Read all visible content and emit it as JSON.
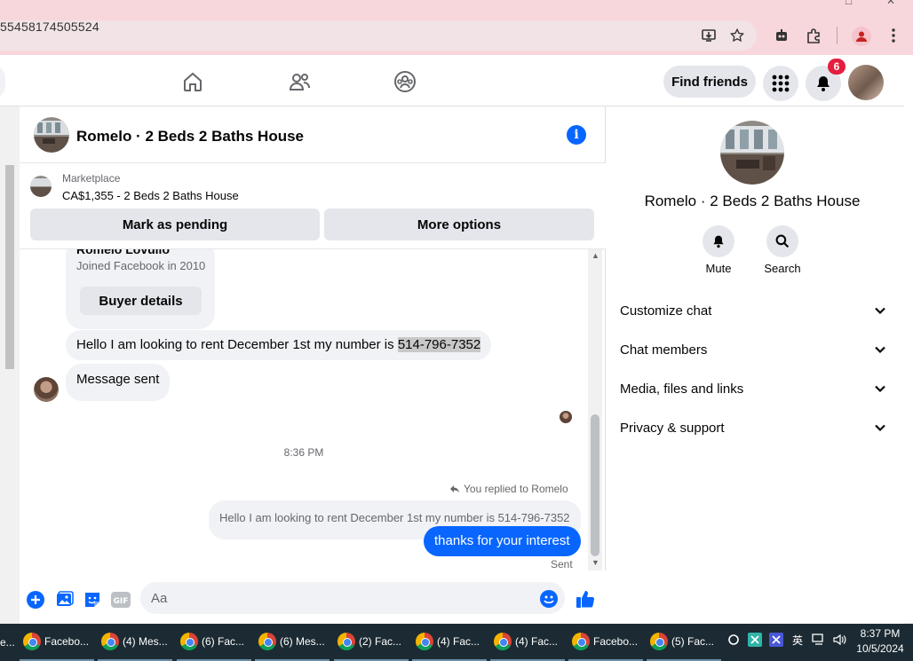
{
  "browser": {
    "url_fragment": "55458174505524",
    "window_controls": [
      "□",
      "✕"
    ]
  },
  "topnav": {
    "find_friends_label": "Find friends",
    "notifications_count": "6"
  },
  "chat": {
    "title": "Romelo · 2 Beds 2 Baths House",
    "marketplace": {
      "label": "Marketplace",
      "listing": "CA$1,355 - 2 Beds 2 Baths House",
      "pending_button": "Mark as pending",
      "more_options_button": "More options"
    },
    "buyer_card": {
      "name": "Romelo Lovullo",
      "joined": "Joined Facebook in 2010",
      "details_button": "Buyer details"
    },
    "messages": [
      {
        "text_before": "Hello I am looking to rent December 1st my number is ",
        "highlight": "514-796-7352"
      },
      {
        "text": "Message sent"
      }
    ],
    "timestamp": "8:36 PM",
    "replied_label": "You replied to Romelo",
    "quoted_text": "Hello I am looking to rent December 1st my number is 514-796-7352",
    "outgoing": "thanks for your interest",
    "sent_label": "Sent",
    "composer_placeholder": "Aa",
    "colors": {
      "accent": "#0866ff",
      "bubble_in": "#f0f2f5"
    }
  },
  "info_panel": {
    "name": "Romelo · 2 Beds 2 Baths House",
    "actions": [
      {
        "label": "Mute",
        "icon": "bell-icon"
      },
      {
        "label": "Search",
        "icon": "search-icon"
      }
    ],
    "sections": [
      {
        "label": "Customize chat"
      },
      {
        "label": "Chat members"
      },
      {
        "label": "Media, files and links"
      },
      {
        "label": "Privacy & support"
      }
    ]
  },
  "taskbar": {
    "edge_label": "e...",
    "tasks": [
      "Facebo...",
      "(4) Mes...",
      "(6) Fac...",
      "(6) Mes...",
      "(2) Fac...",
      "(4) Fac...",
      "(4) Fac...",
      "Facebo...",
      "(5) Fac..."
    ],
    "tray": {
      "lang": "英"
    },
    "time": "8:37 PM",
    "date": "10/5/2024"
  }
}
